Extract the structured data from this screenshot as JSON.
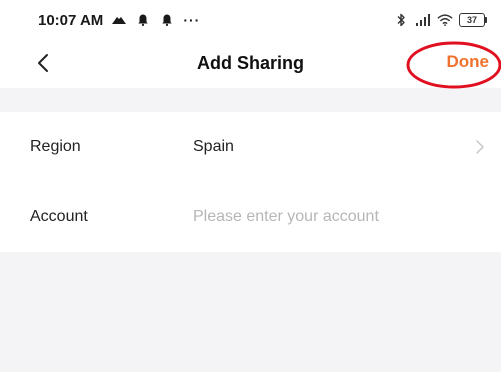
{
  "status_bar": {
    "time": "10:07 AM",
    "left_icons": [
      "cloud-icon",
      "bell-icon",
      "bell-icon"
    ],
    "more": "···",
    "right_icons": [
      "bluetooth-icon",
      "signal-icon",
      "wifi-icon"
    ],
    "battery": "37"
  },
  "nav": {
    "back_icon": "chevron-left-icon",
    "title": "Add Sharing",
    "done_label": "Done",
    "done_color": "#f0722d",
    "highlight_color": "#e01020"
  },
  "form": {
    "region": {
      "label": "Region",
      "value": "Spain",
      "icon": "chevron-right-icon"
    },
    "account": {
      "label": "Account",
      "value": "",
      "placeholder": "Please enter your account"
    }
  },
  "colors": {
    "background": "#f4f4f6",
    "surface": "#ffffff",
    "accent": "#f0722d",
    "placeholder": "#b6b6b6"
  }
}
